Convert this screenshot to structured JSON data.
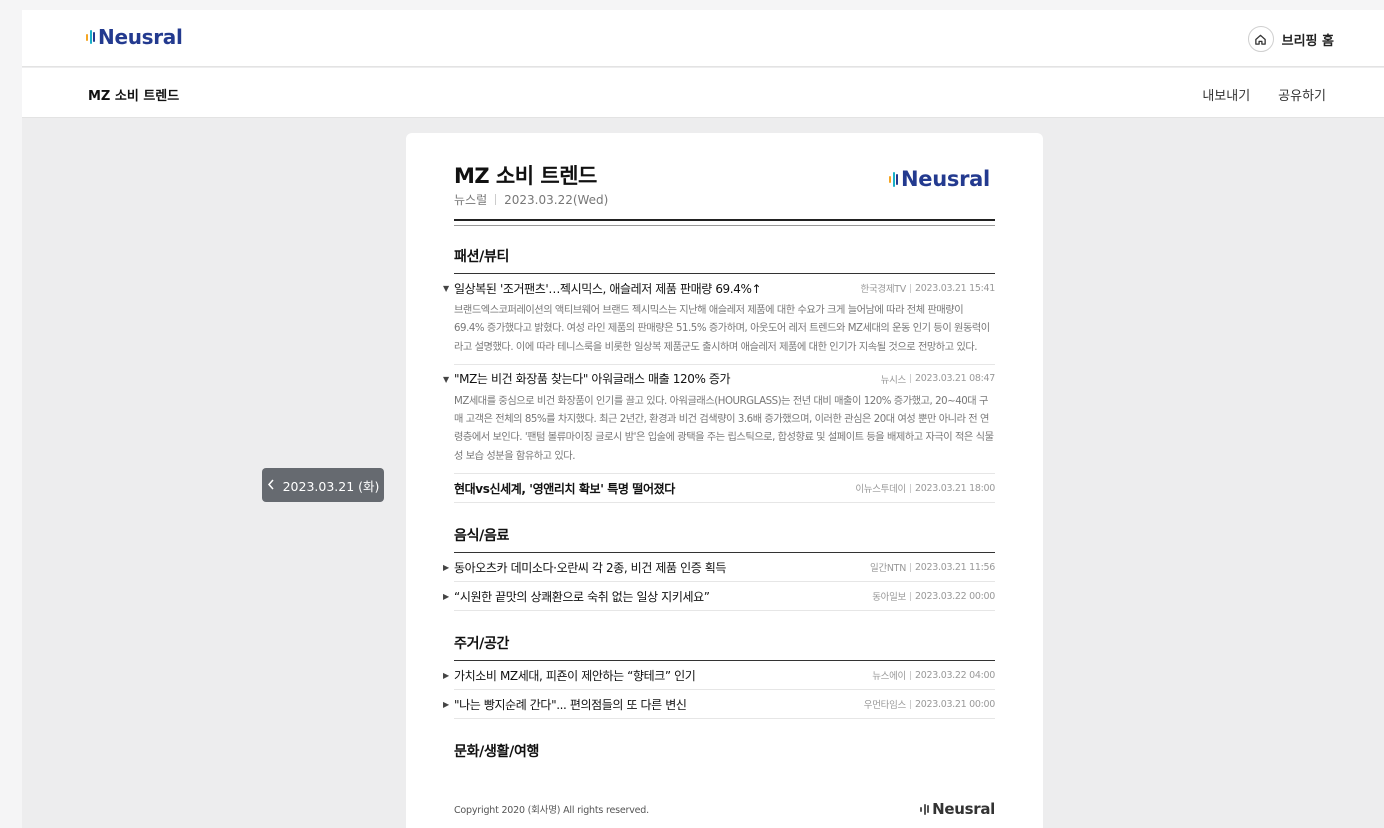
{
  "app": {
    "brand": "Neusral",
    "home_label": "브리핑 홈",
    "home_icon": "home-icon"
  },
  "subbar": {
    "title": "MZ 소비 트렌드",
    "export_label": "내보내기",
    "share_label": "공유하기"
  },
  "prev_button": {
    "label": "2023.03.21 (화)",
    "icon": "chevron-left-icon"
  },
  "doc": {
    "title": "MZ 소비 트렌드",
    "publisher": "뉴스럴",
    "date": "2023.03.22(Wed)",
    "brand": "Neusral"
  },
  "sections": [
    {
      "title": "패션/뷰티",
      "items": [
        {
          "title": "일상복된 '조거팬츠'…젝시믹스, 애슬레저 제품 판매량 69.4%↑",
          "source": "한국경제TV",
          "datetime": "2023.03.21 15:41",
          "expanded": true,
          "body": "브랜드엑스코퍼레이션의 액티브웨어 브랜드 젝시믹스는 지난해 애슬레저 제품에 대한 수요가 크게 늘어남에 따라 전체 판매량이 69.4% 증가했다고 밝혔다. 여성 라인 제품의 판매량은 51.5% 증가하며, 아웃도어 레저 트렌드와 MZ세대의 운동 인기 등이 원동력이라고 설명했다. 이에 따라 테니스룩을 비롯한 일상복 제품군도 출시하며 애슬레저 제품에 대한 인기가 지속될 것으로 전망하고 있다."
        },
        {
          "title": "\"MZ는 비건 화장품 찾는다\" 아워글래스 매출 120% 증가",
          "source": "뉴시스",
          "datetime": "2023.03.21 08:47",
          "expanded": true,
          "body": "MZ세대를 중심으로 비건 화장품이 인기를 끌고 있다. 아워글래스(HOURGLASS)는 전년 대비 매출이 120% 증가했고, 20~40대 구매 고객은 전체의 85%를 차지했다. 최근 2년간, 환경과 비건 검색량이 3.6배 증가했으며, 이러한 관심은 20대 여성 뿐만 아니라 전 연령층에서 보인다. '팬텀 볼류마이징 글로시 밤'은 입술에 광택을 주는 립스틱으로, 합성향료 및 설페이트 등을 배제하고 자극이 적은 식물성 보습 성분을 함유하고 있다."
        },
        {
          "title": "현대vs신세계, '영앤리치 확보' 특명 떨어졌다",
          "source": "이뉴스투데이",
          "datetime": "2023.03.21 18:00",
          "expanded": false,
          "bold": true
        }
      ]
    },
    {
      "title": "음식/음료",
      "items": [
        {
          "title": "동아오츠카 데미소다·오란씨 각 2종, 비건 제품 인증 획득",
          "source": "일간NTN",
          "datetime": "2023.03.21 11:56",
          "expanded": false
        },
        {
          "title": "“시원한 끝맛의 상쾌환으로 숙취 없는 일상 지키세요”",
          "source": "동아일보",
          "datetime": "2023.03.22 00:00",
          "expanded": false
        }
      ]
    },
    {
      "title": "주거/공간",
      "items": [
        {
          "title": "가치소비 MZ세대, 피죤이 제안하는 “향테크” 인기",
          "source": "뉴스에이",
          "datetime": "2023.03.22 04:00",
          "expanded": false
        },
        {
          "title": "\"나는 빵지순례 간다\"... 편의점들의 또 다른 변신",
          "source": "우먼타임스",
          "datetime": "2023.03.21 00:00",
          "expanded": false
        }
      ]
    },
    {
      "title": "문화/생활/여행",
      "items": []
    }
  ],
  "footer": {
    "copyright": "Copyright 2020 (회사명) All rights reserved.",
    "brand": "Neusral"
  },
  "colors": {
    "brand_navy": "#233a8f",
    "brand_teal": "#1ab0c8",
    "brand_orange": "#f5a623",
    "prev_button_bg": "#666a70"
  }
}
